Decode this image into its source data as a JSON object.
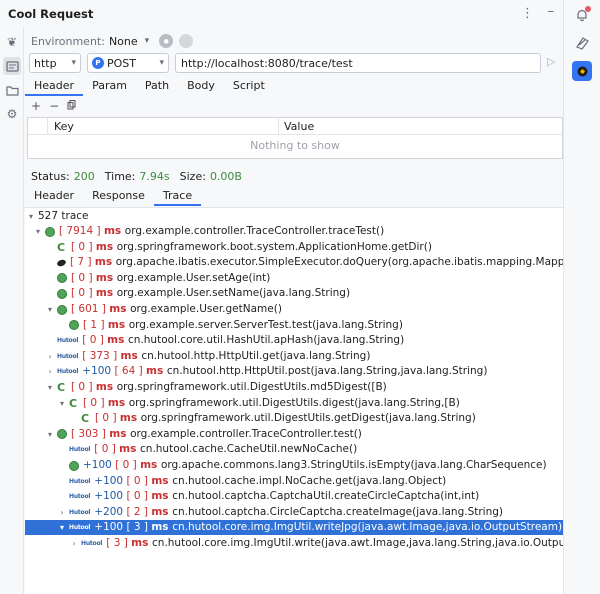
{
  "app": {
    "title": "Cool Request"
  },
  "environment": {
    "label": "Environment:",
    "value": "None"
  },
  "request": {
    "protocol": "http",
    "method": "POST",
    "method_badge": "P",
    "url": "http://localhost:8080/trace/test"
  },
  "request_tabs": [
    "Header",
    "Param",
    "Path",
    "Body",
    "Script"
  ],
  "header_table": {
    "col_key": "Key",
    "col_value": "Value",
    "empty_text": "Nothing to show"
  },
  "status": {
    "status_label": "Status:",
    "status_value": "200",
    "time_label": "Time:",
    "time_value": "7.94s",
    "size_label": "Size:",
    "size_value": "0.00B"
  },
  "response_tabs": [
    "Header",
    "Response",
    "Trace"
  ],
  "trace": {
    "root": "527 trace",
    "ms_label": "ms",
    "rows": [
      {
        "arrow": "down",
        "icon": "green",
        "pre": "",
        "timing": "[ 7914 ]",
        "text": "org.example.controller.TraceController.traceTest()"
      },
      {
        "arrow": "",
        "icon": "spring",
        "pre": "",
        "timing": "[ 0 ]",
        "text": "org.springframework.boot.system.ApplicationHome.getDir()"
      },
      {
        "arrow": "",
        "icon": "ibatis",
        "pre": "",
        "timing": "[ 7 ]",
        "text": "org.apache.ibatis.executor.SimpleExecutor.doQuery(org.apache.ibatis.mapping.MappedStatement,java.la"
      },
      {
        "arrow": "",
        "icon": "green",
        "pre": "",
        "timing": "[ 0 ]",
        "text": "org.example.User.setAge(int)"
      },
      {
        "arrow": "",
        "icon": "green",
        "pre": "",
        "timing": "[ 0 ]",
        "text": "org.example.User.setName(java.lang.String)"
      },
      {
        "arrow": "down",
        "icon": "green",
        "pre": "",
        "timing": "[ 601 ]",
        "text": "org.example.User.getName()"
      },
      {
        "arrow": "",
        "icon": "green",
        "pre": "",
        "timing": "[ 1 ]",
        "text": "org.example.server.ServerTest.test(java.lang.String)"
      },
      {
        "arrow": "",
        "icon": "hutool",
        "pre": "",
        "timing": "[ 0 ]",
        "text": "cn.hutool.core.util.HashUtil.apHash(java.lang.String)"
      },
      {
        "arrow": "right",
        "icon": "hutool",
        "pre": "",
        "timing": "[ 373 ]",
        "text": "cn.hutool.http.HttpUtil.get(java.lang.String)"
      },
      {
        "arrow": "right",
        "icon": "hutool",
        "pre": "+100",
        "timing": "[ 64 ]",
        "text": "cn.hutool.http.HttpUtil.post(java.lang.String,java.lang.String)"
      },
      {
        "arrow": "down",
        "icon": "spring",
        "pre": "",
        "timing": "[ 0 ]",
        "text": "org.springframework.util.DigestUtils.md5Digest([B)"
      },
      {
        "arrow": "down",
        "icon": "spring",
        "pre": "",
        "timing": "[ 0 ]",
        "text": "org.springframework.util.DigestUtils.digest(java.lang.String,[B)"
      },
      {
        "arrow": "",
        "icon": "spring",
        "pre": "",
        "timing": "[ 0 ]",
        "text": "org.springframework.util.DigestUtils.getDigest(java.lang.String)"
      },
      {
        "arrow": "down",
        "icon": "green",
        "pre": "",
        "timing": "[ 303 ]",
        "text": "org.example.controller.TraceController.test()"
      },
      {
        "arrow": "",
        "icon": "hutool",
        "pre": "",
        "timing": "[ 0 ]",
        "text": "cn.hutool.cache.CacheUtil.newNoCache()"
      },
      {
        "arrow": "",
        "icon": "green",
        "pre": "+100",
        "timing": "[ 0 ]",
        "text": "org.apache.commons.lang3.StringUtils.isEmpty(java.lang.CharSequence)"
      },
      {
        "arrow": "",
        "icon": "hutool",
        "pre": "+100",
        "timing": "[ 0 ]",
        "text": "cn.hutool.cache.impl.NoCache.get(java.lang.Object)"
      },
      {
        "arrow": "",
        "icon": "hutool",
        "pre": "+100",
        "timing": "[ 0 ]",
        "text": "cn.hutool.captcha.CaptchaUtil.createCircleCaptcha(int,int)"
      },
      {
        "arrow": "right",
        "icon": "hutool",
        "pre": "+200",
        "timing": "[ 2 ]",
        "text": "cn.hutool.captcha.CircleCaptcha.createImage(java.lang.String)"
      },
      {
        "arrow": "down",
        "icon": "hutool",
        "pre": "+100",
        "timing": "[ 3 ]",
        "text": "cn.hutool.core.img.ImgUtil.writeJpg(java.awt.Image,java.io.OutputStream)"
      },
      {
        "arrow": "right",
        "icon": "hutool",
        "pre": "",
        "timing": "[ 3 ]",
        "text": "cn.hutool.core.img.ImgUtil.write(java.awt.Image,java.lang.String,java.io.OutputStream)"
      }
    ]
  },
  "colors": {
    "accent": "#3574f0",
    "selected_row": "#2f71d6",
    "timing_red": "#c82f2f",
    "status_green": "#3e8a3d"
  }
}
